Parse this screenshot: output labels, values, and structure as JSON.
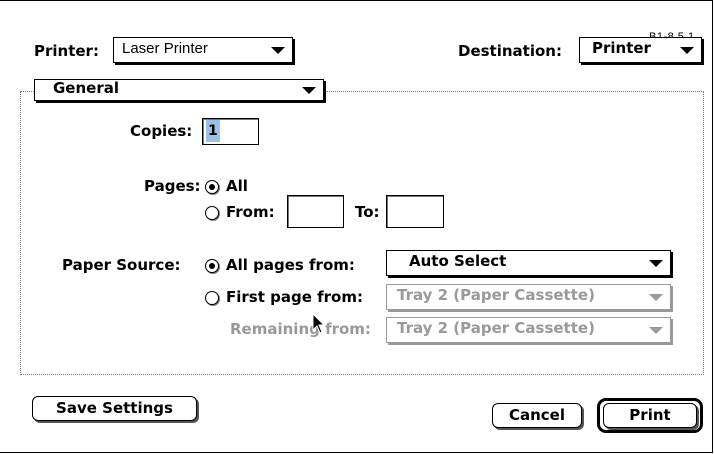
{
  "version_tag": "B1-8.5.1",
  "printer": {
    "label": "Printer:",
    "selected": "Laser Printer"
  },
  "destination": {
    "label": "Destination:",
    "selected": "Printer"
  },
  "panel_menu": {
    "selected": "General"
  },
  "copies": {
    "label": "Copies:",
    "value": "1"
  },
  "pages": {
    "label": "Pages:",
    "all_label": "All",
    "from_label": "From:",
    "to_label": "To:",
    "from_value": "",
    "to_value": ""
  },
  "paper_source": {
    "label": "Paper Source:",
    "all_pages_label": "All pages from:",
    "all_pages_value": "Auto Select",
    "first_page_label": "First page from:",
    "first_page_value": "Tray 2 (Paper Cassette)",
    "remaining_label": "Remaining from:",
    "remaining_value": "Tray 2 (Paper Cassette)"
  },
  "buttons": {
    "save_settings": "Save Settings",
    "cancel": "Cancel",
    "print": "Print"
  },
  "colors": {
    "selection_highlight": "#9ec0e6",
    "disabled_text": "#999999"
  }
}
